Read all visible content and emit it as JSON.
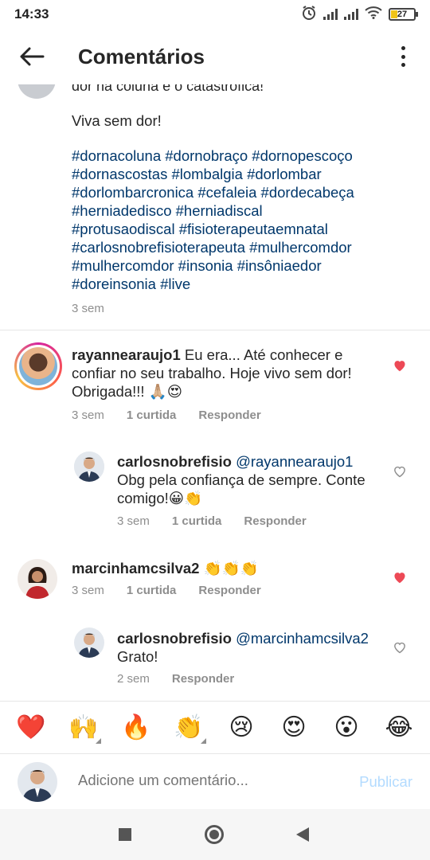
{
  "status_bar": {
    "time": "14:33",
    "battery": "27"
  },
  "header": {
    "title": "Comentários"
  },
  "caption": {
    "cut_line": "dor na coluna é o catastrófica!",
    "text": "Viva sem dor!",
    "hashtag_lines": [
      "#dornacoluna #dornobraço #dornopescoço",
      "#dornascostas #lombalgia #dorlombar",
      "#dorlombarcronica #cefaleia #dordecabeça",
      "#herniadedisco #herniadiscal",
      "#protusaodiscal #fisioterapeutaemnatal",
      "#carlosnobrefisioterapeuta #mulhercomdor",
      "#mulhercomdor #insonia #insôniaedor",
      "#doreinsonia #live"
    ],
    "time": "3 sem"
  },
  "comments": [
    {
      "username": "rayannearaujo1",
      "text_line1": " Eu era... Até conhecer e",
      "text_line2": "confiar no seu trabalho. Hoje vivo sem dor!",
      "text_line3": "Obrigada!!! 🙏🏼😍",
      "time": "3 sem",
      "likes": "1 curtida",
      "reply": "Responder",
      "liked": true
    },
    {
      "username": "carlosnobrefisio",
      "mention": " @rayannearaujo1",
      "text_line1": "Obg pela confiança de sempre. Conte",
      "text_line2": "comigo!😀👏",
      "time": "3 sem",
      "likes": "1 curtida",
      "reply": "Responder",
      "liked": false
    },
    {
      "username": "marcinhamcsilva2",
      "text_line1": " 👏👏👏",
      "time": "3 sem",
      "likes": "1 curtida",
      "reply": "Responder",
      "liked": true
    },
    {
      "username": "carlosnobrefisio",
      "mention": " @marcinhamcsilva2",
      "text_line1": "Grato!",
      "time": "2 sem",
      "reply": "Responder",
      "liked": false
    }
  ],
  "emoji_bar": [
    "❤️",
    "🙌",
    "🔥",
    "👏",
    "😢",
    "😍",
    "😮",
    "😂"
  ],
  "input": {
    "placeholder": "Adicione um comentário...",
    "publish_label": "Publicar"
  },
  "colors": {
    "like_red": "#ed4956",
    "hashtag_blue": "#00376b",
    "publish_disabled": "#b3dbff"
  }
}
